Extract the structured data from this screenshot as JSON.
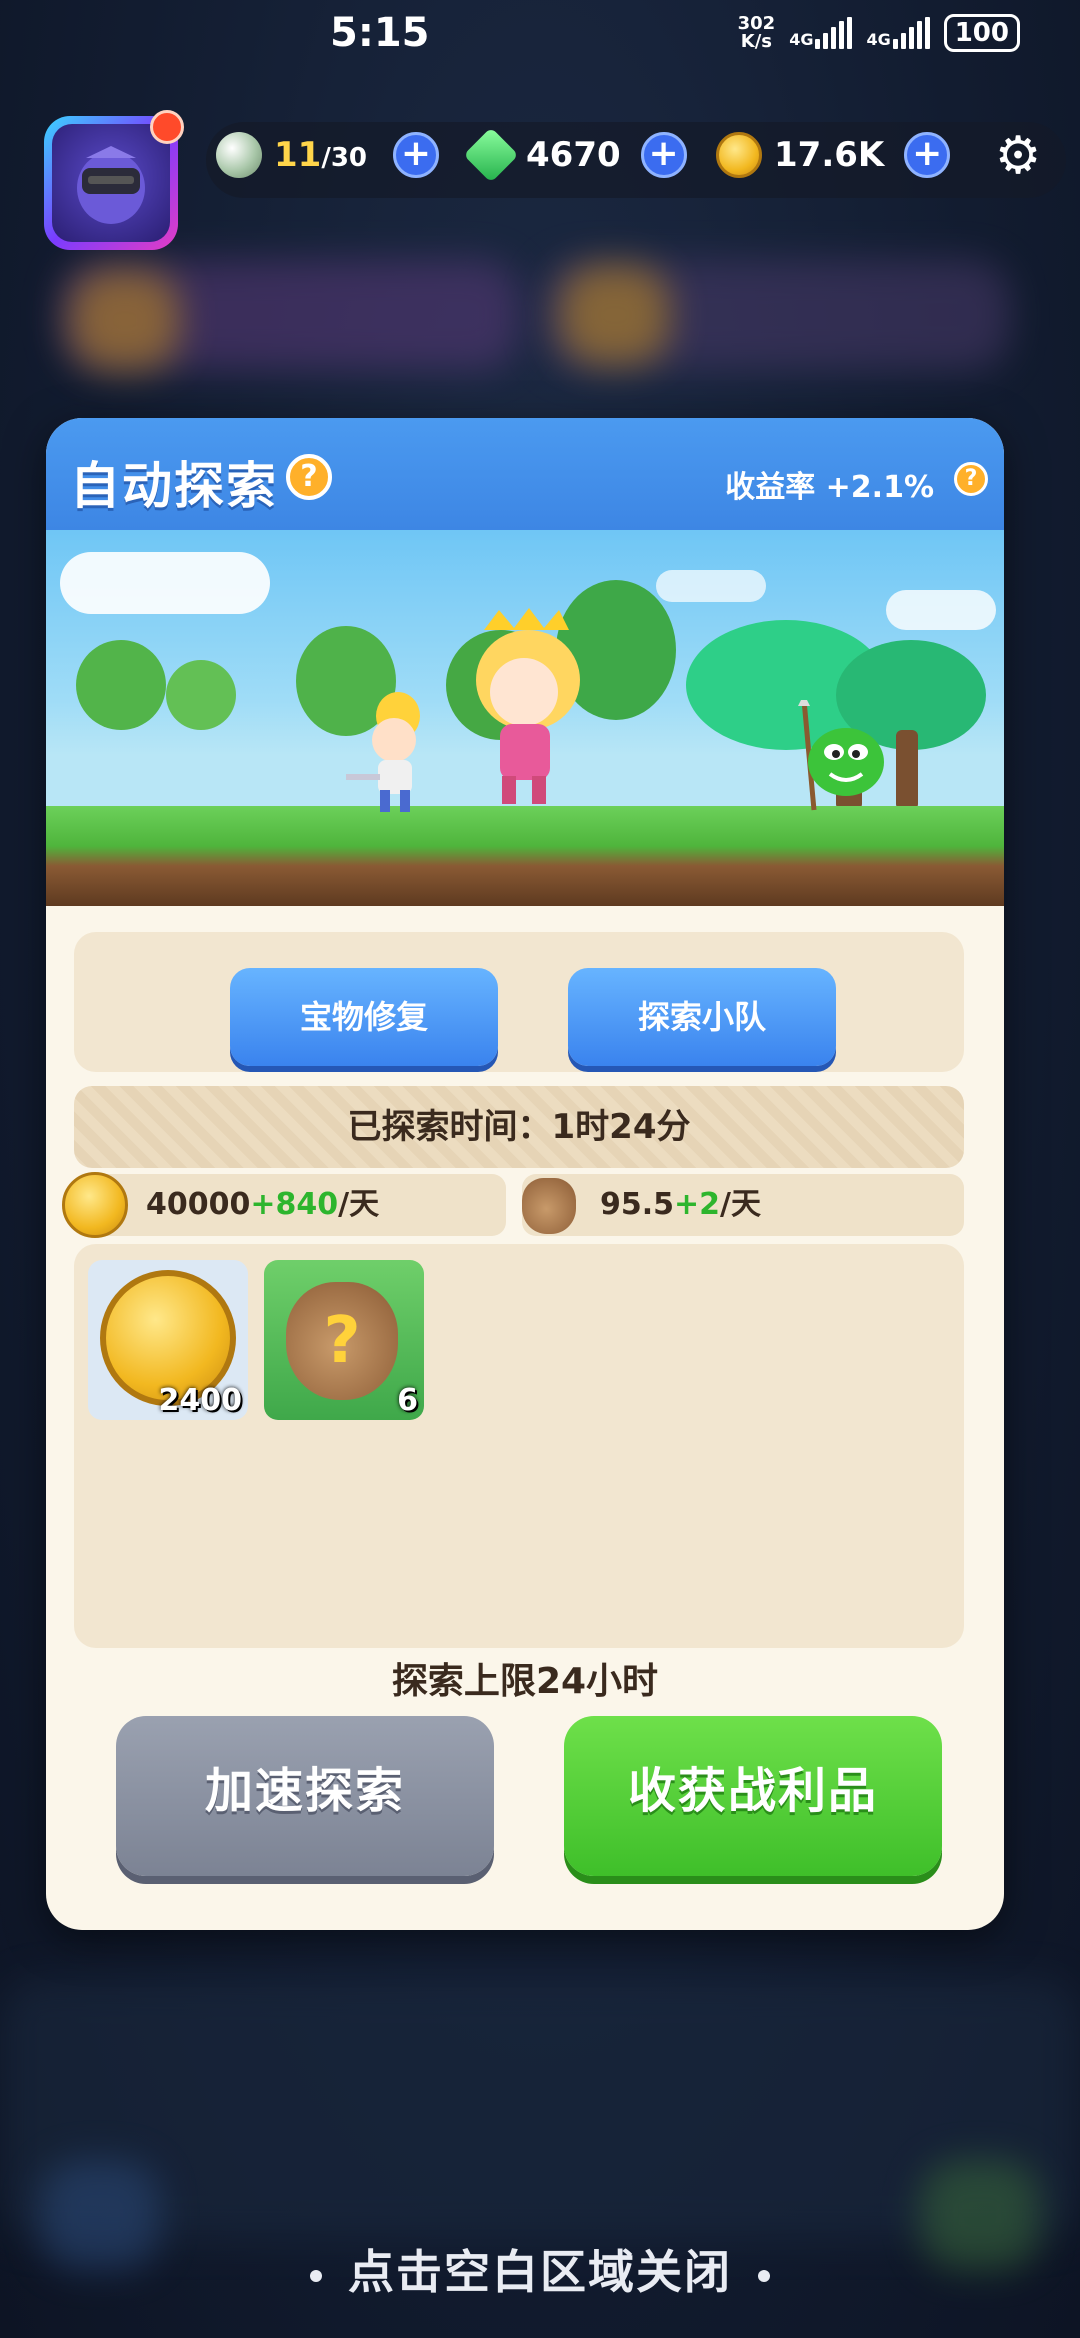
{
  "status_bar": {
    "time": "5:15",
    "net_speed_value": "302",
    "net_speed_unit": "K/s",
    "signal_1": "4G",
    "signal_2": "4G",
    "battery": "100"
  },
  "resources": {
    "energy_current": "11",
    "energy_max": "/30",
    "gems": "4670",
    "coins": "17.6K",
    "add_symbol": "+"
  },
  "dialog": {
    "title": "自动探索",
    "help_symbol": "?",
    "yield_rate_label": "收益率",
    "yield_rate_value": "+2.1%",
    "treasure_repair_button": "宝物修复",
    "explore_team_button": "探索小队",
    "explored_time_label": "已探索时间：",
    "explored_time_value": "1时24分",
    "coin_rate_base": "40000",
    "coin_rate_bonus": "+840",
    "coin_rate_unit": "/天",
    "bag_rate_base": "95.5",
    "bag_rate_bonus": "+2",
    "bag_rate_unit": "/天",
    "loot": [
      {
        "name": "coin",
        "count": "2400"
      },
      {
        "name": "mystery-bag",
        "count": "6"
      }
    ],
    "limit_text_prefix": "探索上限",
    "limit_text_hours": "24",
    "limit_text_suffix": "小时",
    "speed_up_button": "加速探索",
    "collect_button": "收获战利品"
  },
  "close_hint": "点击空白区域关闭",
  "colors": {
    "header_blue": "#3d86e4",
    "button_blue": "#3a83ee",
    "button_green": "#3fbf2a",
    "button_gray": "#7c8394",
    "bonus_green": "#2db52d",
    "panel_cream": "#fbf6ea"
  }
}
